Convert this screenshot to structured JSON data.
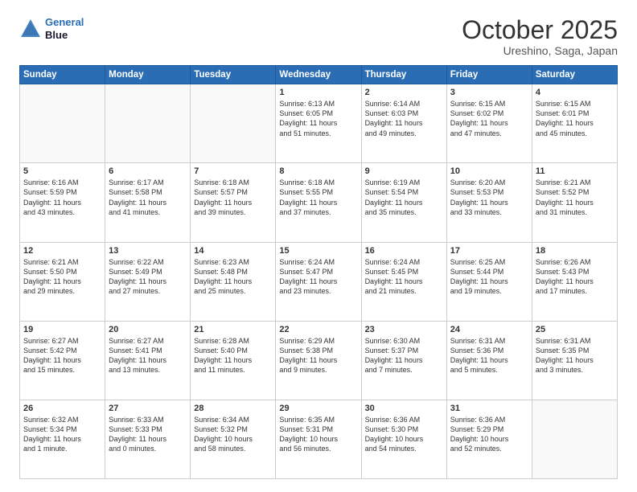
{
  "header": {
    "logo_line1": "General",
    "logo_line2": "Blue",
    "month": "October 2025",
    "location": "Ureshino, Saga, Japan"
  },
  "weekdays": [
    "Sunday",
    "Monday",
    "Tuesday",
    "Wednesday",
    "Thursday",
    "Friday",
    "Saturday"
  ],
  "weeks": [
    [
      {
        "day": "",
        "info": ""
      },
      {
        "day": "",
        "info": ""
      },
      {
        "day": "",
        "info": ""
      },
      {
        "day": "1",
        "info": "Sunrise: 6:13 AM\nSunset: 6:05 PM\nDaylight: 11 hours\nand 51 minutes."
      },
      {
        "day": "2",
        "info": "Sunrise: 6:14 AM\nSunset: 6:03 PM\nDaylight: 11 hours\nand 49 minutes."
      },
      {
        "day": "3",
        "info": "Sunrise: 6:15 AM\nSunset: 6:02 PM\nDaylight: 11 hours\nand 47 minutes."
      },
      {
        "day": "4",
        "info": "Sunrise: 6:15 AM\nSunset: 6:01 PM\nDaylight: 11 hours\nand 45 minutes."
      }
    ],
    [
      {
        "day": "5",
        "info": "Sunrise: 6:16 AM\nSunset: 5:59 PM\nDaylight: 11 hours\nand 43 minutes."
      },
      {
        "day": "6",
        "info": "Sunrise: 6:17 AM\nSunset: 5:58 PM\nDaylight: 11 hours\nand 41 minutes."
      },
      {
        "day": "7",
        "info": "Sunrise: 6:18 AM\nSunset: 5:57 PM\nDaylight: 11 hours\nand 39 minutes."
      },
      {
        "day": "8",
        "info": "Sunrise: 6:18 AM\nSunset: 5:55 PM\nDaylight: 11 hours\nand 37 minutes."
      },
      {
        "day": "9",
        "info": "Sunrise: 6:19 AM\nSunset: 5:54 PM\nDaylight: 11 hours\nand 35 minutes."
      },
      {
        "day": "10",
        "info": "Sunrise: 6:20 AM\nSunset: 5:53 PM\nDaylight: 11 hours\nand 33 minutes."
      },
      {
        "day": "11",
        "info": "Sunrise: 6:21 AM\nSunset: 5:52 PM\nDaylight: 11 hours\nand 31 minutes."
      }
    ],
    [
      {
        "day": "12",
        "info": "Sunrise: 6:21 AM\nSunset: 5:50 PM\nDaylight: 11 hours\nand 29 minutes."
      },
      {
        "day": "13",
        "info": "Sunrise: 6:22 AM\nSunset: 5:49 PM\nDaylight: 11 hours\nand 27 minutes."
      },
      {
        "day": "14",
        "info": "Sunrise: 6:23 AM\nSunset: 5:48 PM\nDaylight: 11 hours\nand 25 minutes."
      },
      {
        "day": "15",
        "info": "Sunrise: 6:24 AM\nSunset: 5:47 PM\nDaylight: 11 hours\nand 23 minutes."
      },
      {
        "day": "16",
        "info": "Sunrise: 6:24 AM\nSunset: 5:45 PM\nDaylight: 11 hours\nand 21 minutes."
      },
      {
        "day": "17",
        "info": "Sunrise: 6:25 AM\nSunset: 5:44 PM\nDaylight: 11 hours\nand 19 minutes."
      },
      {
        "day": "18",
        "info": "Sunrise: 6:26 AM\nSunset: 5:43 PM\nDaylight: 11 hours\nand 17 minutes."
      }
    ],
    [
      {
        "day": "19",
        "info": "Sunrise: 6:27 AM\nSunset: 5:42 PM\nDaylight: 11 hours\nand 15 minutes."
      },
      {
        "day": "20",
        "info": "Sunrise: 6:27 AM\nSunset: 5:41 PM\nDaylight: 11 hours\nand 13 minutes."
      },
      {
        "day": "21",
        "info": "Sunrise: 6:28 AM\nSunset: 5:40 PM\nDaylight: 11 hours\nand 11 minutes."
      },
      {
        "day": "22",
        "info": "Sunrise: 6:29 AM\nSunset: 5:38 PM\nDaylight: 11 hours\nand 9 minutes."
      },
      {
        "day": "23",
        "info": "Sunrise: 6:30 AM\nSunset: 5:37 PM\nDaylight: 11 hours\nand 7 minutes."
      },
      {
        "day": "24",
        "info": "Sunrise: 6:31 AM\nSunset: 5:36 PM\nDaylight: 11 hours\nand 5 minutes."
      },
      {
        "day": "25",
        "info": "Sunrise: 6:31 AM\nSunset: 5:35 PM\nDaylight: 11 hours\nand 3 minutes."
      }
    ],
    [
      {
        "day": "26",
        "info": "Sunrise: 6:32 AM\nSunset: 5:34 PM\nDaylight: 11 hours\nand 1 minute."
      },
      {
        "day": "27",
        "info": "Sunrise: 6:33 AM\nSunset: 5:33 PM\nDaylight: 11 hours\nand 0 minutes."
      },
      {
        "day": "28",
        "info": "Sunrise: 6:34 AM\nSunset: 5:32 PM\nDaylight: 10 hours\nand 58 minutes."
      },
      {
        "day": "29",
        "info": "Sunrise: 6:35 AM\nSunset: 5:31 PM\nDaylight: 10 hours\nand 56 minutes."
      },
      {
        "day": "30",
        "info": "Sunrise: 6:36 AM\nSunset: 5:30 PM\nDaylight: 10 hours\nand 54 minutes."
      },
      {
        "day": "31",
        "info": "Sunrise: 6:36 AM\nSunset: 5:29 PM\nDaylight: 10 hours\nand 52 minutes."
      },
      {
        "day": "",
        "info": ""
      }
    ]
  ]
}
